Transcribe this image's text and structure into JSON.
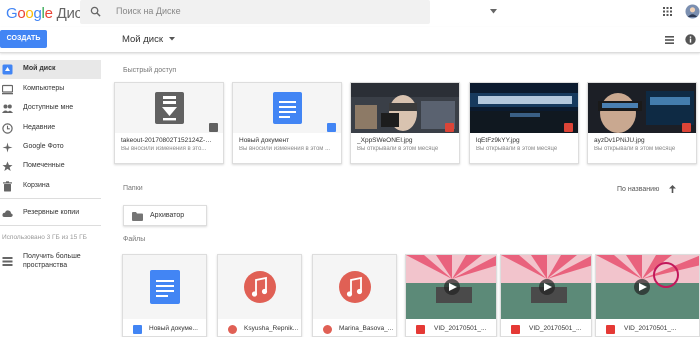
{
  "app": {
    "logo_letters": [
      "G",
      "o",
      "o",
      "g",
      "l",
      "e"
    ],
    "product": "Диск"
  },
  "search": {
    "placeholder": "Поиск на Диске"
  },
  "toolbar": {
    "create_label": "СОЗДАТЬ",
    "breadcrumb_title": "Мой диск"
  },
  "sidebar": {
    "items": [
      {
        "label": "Мой диск",
        "icon": "drive-icon",
        "active": true
      },
      {
        "label": "Компьютеры",
        "icon": "computer-icon"
      },
      {
        "label": "Доступные мне",
        "icon": "people-icon"
      },
      {
        "label": "Недавние",
        "icon": "clock-icon"
      },
      {
        "label": "Google Фото",
        "icon": "photos-icon"
      },
      {
        "label": "Помеченные",
        "icon": "star-icon"
      },
      {
        "label": "Корзина",
        "icon": "trash-icon"
      }
    ],
    "backup_label": "Резервные копии",
    "storage_text": "Использовано 3 ГБ из 15 ГБ",
    "upgrade_label_1": "Получить больше",
    "upgrade_label_2": "пространства"
  },
  "quick_access": {
    "heading": "Быстрый доступ",
    "cards": [
      {
        "title": "takeout-20170802T152124Z-00...",
        "subtitle": "Вы вносили изменения в это...",
        "kind": "archive"
      },
      {
        "title": "Новый документ",
        "subtitle": "Вы вносили изменения в этом ...",
        "kind": "doc"
      },
      {
        "title": "_XppSWeONEI.jpg",
        "subtitle": "Вы открывали в этом месяце",
        "kind": "photo"
      },
      {
        "title": "lqEtFz9kYY.jpg",
        "subtitle": "Вы открывали в этом месяце",
        "kind": "photo"
      },
      {
        "title": "ayzDv1PNiJU.jpg",
        "subtitle": "Вы открывали в этом месяце",
        "kind": "photo"
      }
    ]
  },
  "folders": {
    "heading": "Папки",
    "sort_label": "По названию",
    "items": [
      {
        "name": "Архиватор"
      }
    ]
  },
  "files": {
    "heading": "Файлы",
    "items": [
      {
        "name": "Новый докуме...",
        "kind": "doc"
      },
      {
        "name": "Ksyusha_Repnik...",
        "kind": "audio"
      },
      {
        "name": "Marina_Basova_...",
        "kind": "audio"
      },
      {
        "name": "VID_20170501_...",
        "kind": "video"
      },
      {
        "name": "VID_20170501_...",
        "kind": "video"
      },
      {
        "name": "VID_20170501_...",
        "kind": "video"
      }
    ]
  },
  "colors": {
    "accent": "#4285f4",
    "doc_blue": "#4285f4",
    "music_red": "#e06055",
    "image_red": "#db4437"
  }
}
